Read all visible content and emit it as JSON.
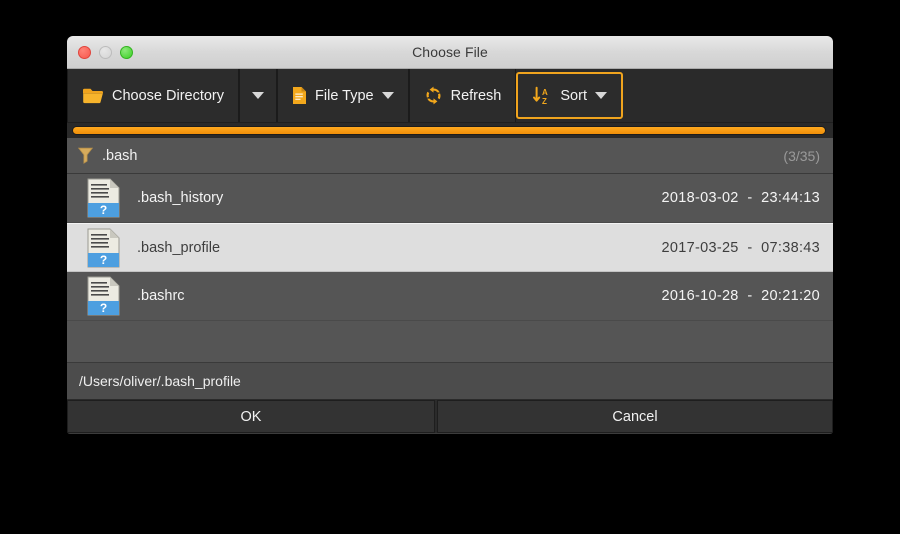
{
  "window": {
    "title": "Choose File",
    "traffic_lights": [
      {
        "name": "close",
        "color": "#f6574c"
      },
      {
        "name": "minimize",
        "color": "#d4d4d4"
      },
      {
        "name": "maximize",
        "color": "#3bd024"
      }
    ]
  },
  "toolbar": {
    "choose_directory_label": "Choose Directory",
    "choose_directory_icon": "folder-icon",
    "choose_directory_caret_icon": "chevron-down-icon",
    "file_type_label": "File Type",
    "file_type_icon": "document-icon",
    "file_type_caret_icon": "chevron-down-icon",
    "refresh_label": "Refresh",
    "refresh_icon": "refresh-icon",
    "sort_label": "Sort",
    "sort_icon": "sort-alpha-down-icon",
    "sort_caret_icon": "chevron-down-icon",
    "sort_focused": true,
    "accent_color": "#f0a41e"
  },
  "filter": {
    "icon": "funnel-icon",
    "text": ".bash",
    "count": "(3/35)"
  },
  "files": [
    {
      "icon": "binary-file-icon",
      "name": ".bash_history",
      "date": "2018-03-02",
      "separator": "-",
      "time": "23:44:13",
      "selected": false
    },
    {
      "icon": "binary-file-icon",
      "name": ".bash_profile",
      "date": "2017-03-25",
      "separator": "-",
      "time": "07:38:43",
      "selected": true
    },
    {
      "icon": "binary-file-icon",
      "name": ".bashrc",
      "date": "2016-10-28",
      "separator": "-",
      "time": "20:21:20",
      "selected": false
    }
  ],
  "path": {
    "value": "/Users/oliver/.bash_profile"
  },
  "actions": {
    "ok_label": "OK",
    "cancel_label": "Cancel"
  }
}
